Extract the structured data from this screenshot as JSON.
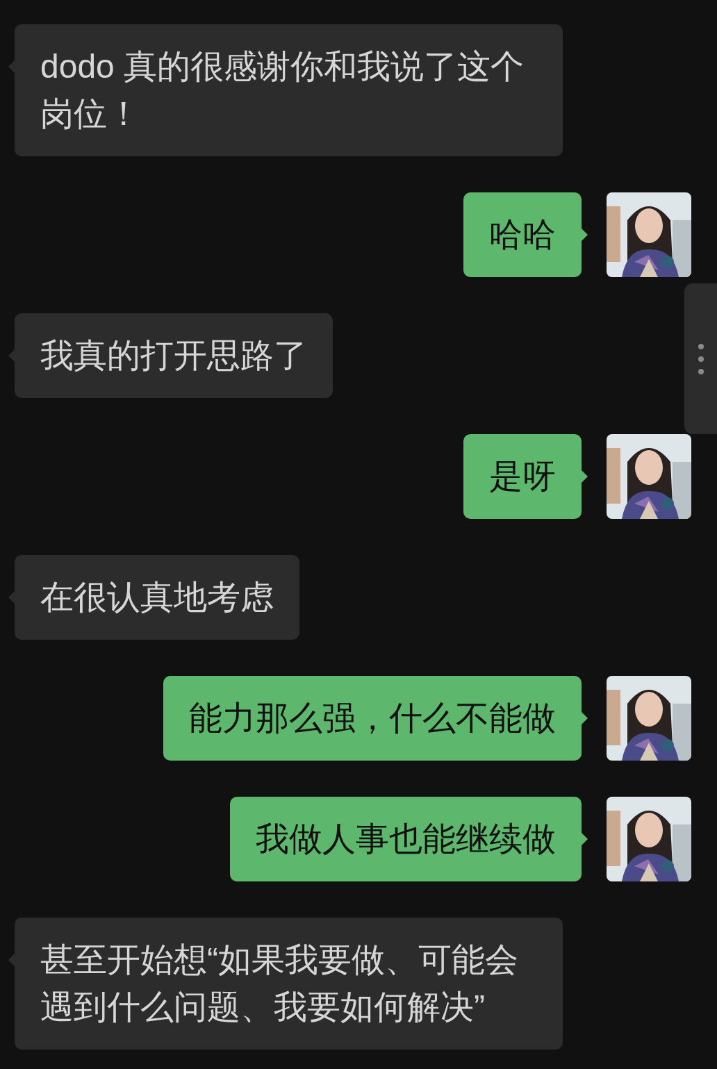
{
  "messages": [
    {
      "kind": "incoming",
      "text": "dodo 真的很感谢你和我说了这个岗位！"
    },
    {
      "kind": "outgoing",
      "text": "哈哈"
    },
    {
      "kind": "incoming",
      "text": "我真的打开思路了"
    },
    {
      "kind": "outgoing",
      "text": "是呀"
    },
    {
      "kind": "incoming",
      "text": "在很认真地考虑"
    },
    {
      "kind": "outgoing",
      "text": "能力那么强，什么不能做"
    },
    {
      "kind": "outgoing",
      "text": "我做人事也能继续做"
    },
    {
      "kind": "incoming",
      "text": "甚至开始想“如果我要做、可能会遇到什么问题、我要如何解决”"
    }
  ]
}
